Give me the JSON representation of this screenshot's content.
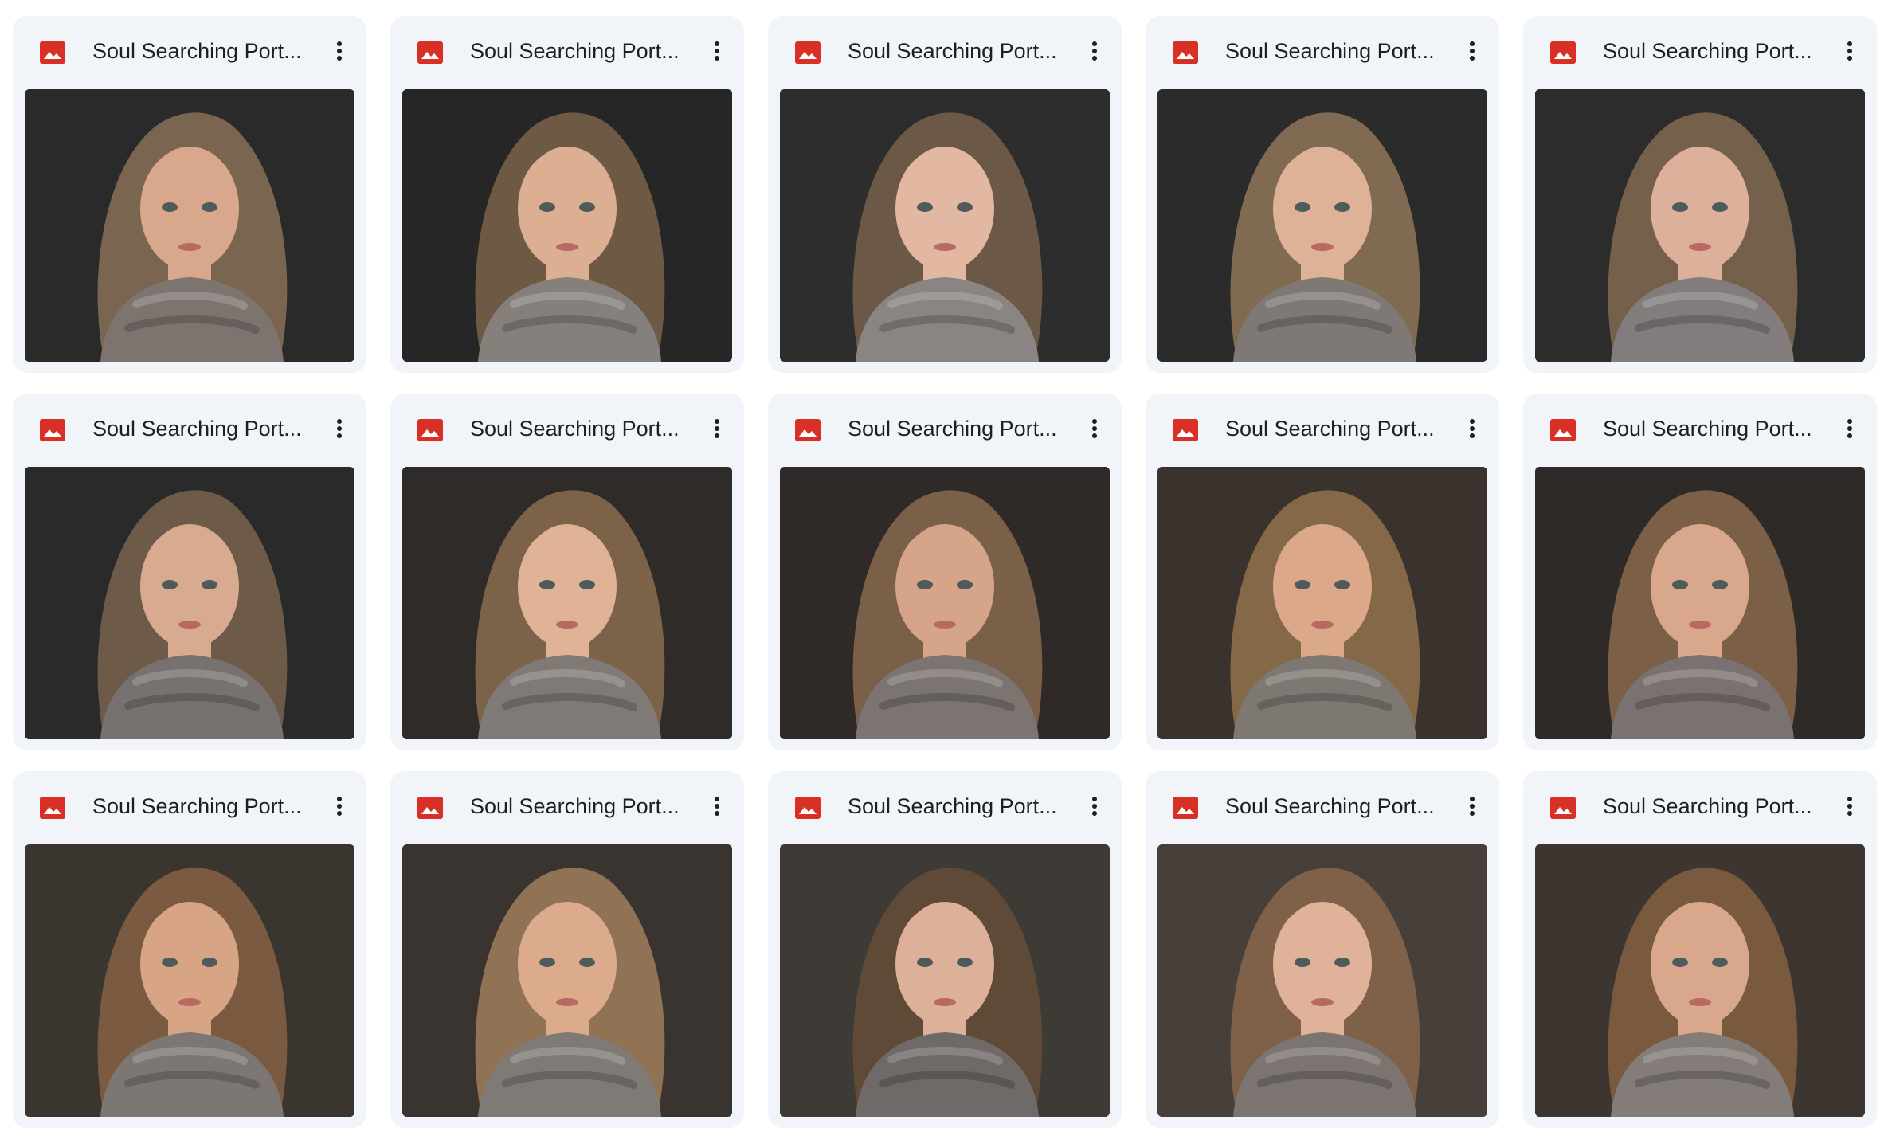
{
  "files": [
    {
      "name": "Soul Searching Port...",
      "type_icon": "image-file-icon",
      "menu_icon": "more-vert-icon",
      "thumbnail": {
        "background": "#2a2a2a",
        "hair": "#7a6550",
        "skin": "#d9a88c",
        "scarf": "#7d7470"
      }
    },
    {
      "name": "Soul Searching Port...",
      "type_icon": "image-file-icon",
      "menu_icon": "more-vert-icon",
      "thumbnail": {
        "background": "#262626",
        "hair": "#6e5a44",
        "skin": "#dcae92",
        "scarf": "#86807c"
      }
    },
    {
      "name": "Soul Searching Port...",
      "type_icon": "image-file-icon",
      "menu_icon": "more-vert-icon",
      "thumbnail": {
        "background": "#2d2d2d",
        "hair": "#6b5846",
        "skin": "#e2b8a2",
        "scarf": "#8a8482"
      }
    },
    {
      "name": "Soul Searching Port...",
      "type_icon": "image-file-icon",
      "menu_icon": "more-vert-icon",
      "thumbnail": {
        "background": "#2b2b2b",
        "hair": "#806a52",
        "skin": "#deb296",
        "scarf": "#7f7976"
      }
    },
    {
      "name": "Soul Searching Port...",
      "type_icon": "image-file-icon",
      "menu_icon": "more-vert-icon",
      "thumbnail": {
        "background": "#2c2c2c",
        "hair": "#75604c",
        "skin": "#dcb09a",
        "scarf": "#827d7c"
      }
    },
    {
      "name": "Soul Searching Port...",
      "type_icon": "image-file-icon",
      "menu_icon": "more-vert-icon",
      "thumbnail": {
        "background": "#2a2a2a",
        "hair": "#6d5a48",
        "skin": "#d8aa90",
        "scarf": "#77726f"
      }
    },
    {
      "name": "Soul Searching Port...",
      "type_icon": "image-file-icon",
      "menu_icon": "more-vert-icon",
      "thumbnail": {
        "background": "#2e2b28",
        "hair": "#7c6249",
        "skin": "#e0b296",
        "scarf": "#807a76"
      }
    },
    {
      "name": "Soul Searching Port...",
      "type_icon": "image-file-icon",
      "menu_icon": "more-vert-icon",
      "thumbnail": {
        "background": "#2f2a27",
        "hair": "#7a6048",
        "skin": "#d6a488",
        "scarf": "#7b7470"
      }
    },
    {
      "name": "Soul Searching Port...",
      "type_icon": "image-file-icon",
      "menu_icon": "more-vert-icon",
      "thumbnail": {
        "background": "#3a322c",
        "hair": "#856848",
        "skin": "#dba88a",
        "scarf": "#7e7873"
      }
    },
    {
      "name": "Soul Searching Port...",
      "type_icon": "image-file-icon",
      "menu_icon": "more-vert-icon",
      "thumbnail": {
        "background": "#2e2a28",
        "hair": "#7b5f46",
        "skin": "#d9a78c",
        "scarf": "#7a7270"
      }
    },
    {
      "name": "Soul Searching Port...",
      "type_icon": "image-file-icon",
      "menu_icon": "more-vert-icon",
      "thumbnail": {
        "background": "#3b3530",
        "hair": "#7a5a40",
        "skin": "#d8a486",
        "scarf": "#7d7774"
      }
    },
    {
      "name": "Soul Searching Port...",
      "type_icon": "image-file-icon",
      "menu_icon": "more-vert-icon",
      "thumbnail": {
        "background": "#3a3430",
        "hair": "#8f7354",
        "skin": "#dcab8e",
        "scarf": "#7f7a76"
      }
    },
    {
      "name": "Soul Searching Port...",
      "type_icon": "image-file-icon",
      "menu_icon": "more-vert-icon",
      "thumbnail": {
        "background": "#3e3a36",
        "hair": "#5f4a38",
        "skin": "#ddb09a",
        "scarf": "#6f6a68"
      }
    },
    {
      "name": "Soul Searching Port...",
      "type_icon": "image-file-icon",
      "menu_icon": "more-vert-icon",
      "thumbnail": {
        "background": "#47403a",
        "hair": "#7e6148",
        "skin": "#e0b29a",
        "scarf": "#7c7470"
      }
    },
    {
      "name": "Soul Searching Port...",
      "type_icon": "image-file-icon",
      "menu_icon": "more-vert-icon",
      "thumbnail": {
        "background": "#3c3530",
        "hair": "#7a5a3e",
        "skin": "#d9a88c",
        "scarf": "#837c78"
      }
    }
  ],
  "colors": {
    "card_background": "#f1f4f9",
    "page_background": "#ffffff",
    "text": "#1f1f1f",
    "image_icon_red": "#d93025"
  }
}
